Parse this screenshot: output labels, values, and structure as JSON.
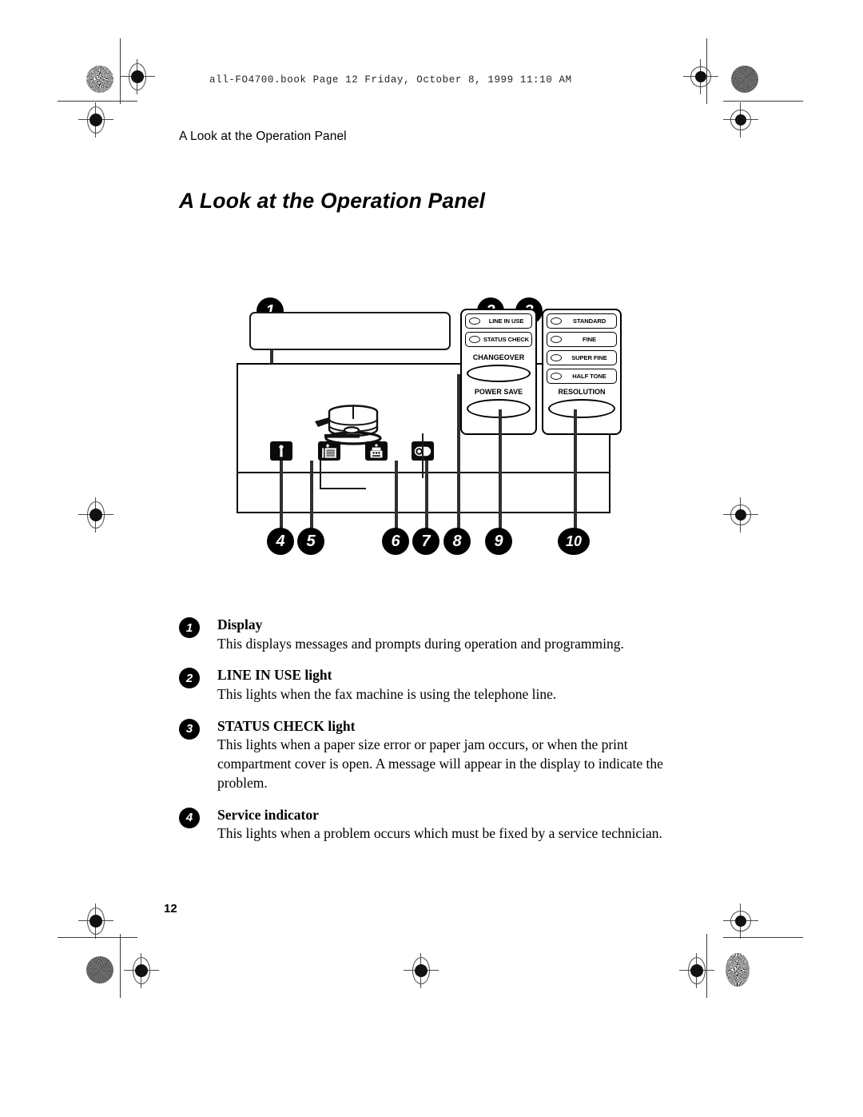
{
  "print_marks": {
    "file_stamp": "all-FO4700.book  Page 12  Friday, October 8, 1999  11:10 AM"
  },
  "header": {
    "running_head": "A Look at the Operation Panel",
    "page_title": "A Look at the Operation Panel",
    "folio": "12"
  },
  "diagram": {
    "callouts": [
      {
        "n": "1"
      },
      {
        "n": "2"
      },
      {
        "n": "3"
      },
      {
        "n": "4"
      },
      {
        "n": "5"
      },
      {
        "n": "6"
      },
      {
        "n": "7"
      },
      {
        "n": "8"
      },
      {
        "n": "9"
      },
      {
        "n": "10"
      }
    ],
    "status_lamps": [
      {
        "label": "LINE IN USE"
      },
      {
        "label": "STATUS CHECK"
      }
    ],
    "resolution_lamps": [
      {
        "label": "STANDARD"
      },
      {
        "label": "FINE"
      },
      {
        "label": "SUPER FINE"
      },
      {
        "label": "HALF TONE"
      }
    ],
    "buttons": [
      {
        "label": "CHANGEOVER"
      },
      {
        "label": "POWER SAVE"
      },
      {
        "label": "RESOLUTION"
      }
    ],
    "icon_keys": [
      {
        "name": "service-indicator-icon"
      },
      {
        "name": "paper-indicator-icon"
      },
      {
        "name": "drum-cartridge-indicator-icon"
      },
      {
        "name": "toner-cartridge-indicator-icon"
      }
    ]
  },
  "descriptions": [
    {
      "num": "1",
      "term": "Display",
      "body": "This displays messages and prompts during operation and programming."
    },
    {
      "num": "2",
      "term": "LINE IN USE light",
      "body": "This lights when the fax machine is using the telephone line."
    },
    {
      "num": "3",
      "term": "STATUS CHECK light",
      "body": "This lights when a paper size error or paper jam occurs, or when the print compartment cover is open. A message will appear in the display to indicate the problem."
    },
    {
      "num": "4",
      "term": "Service indicator",
      "body": "This lights when a problem occurs which must be fixed by a service technician."
    }
  ]
}
